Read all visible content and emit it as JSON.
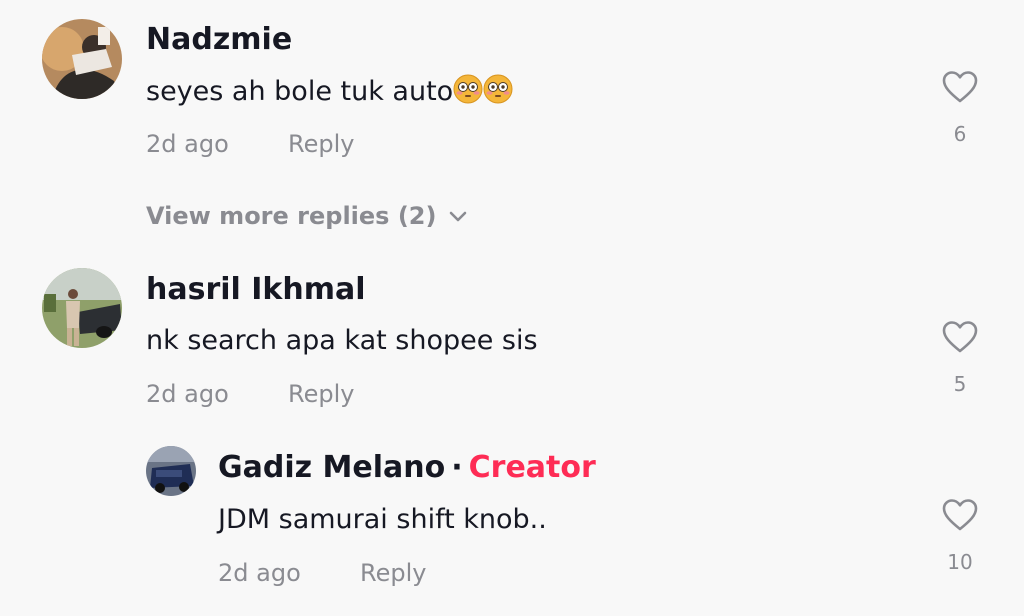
{
  "comments": [
    {
      "username": "Nadzmie",
      "text": "seyes ah bole tuk auto",
      "emoji": [
        "flushed-face",
        "flushed-face"
      ],
      "time": "2d ago",
      "reply_label": "Reply",
      "likes": "6",
      "view_more": "View more replies (2)"
    },
    {
      "username": "hasril Ikhmal",
      "text": "nk search apa kat shopee sis",
      "time": "2d ago",
      "reply_label": "Reply",
      "likes": "5"
    }
  ],
  "reply": {
    "username": "Gadiz Melano",
    "separator": "·",
    "badge": "Creator",
    "text": "JDM samurai shift knob..",
    "time": "2d ago",
    "reply_label": "Reply",
    "likes": "10"
  },
  "colors": {
    "background": "#f8f8f8",
    "text": "#161823",
    "secondary": "#8a8b91",
    "creator": "#fe2c55"
  },
  "icons": {
    "like": "heart-outline-icon",
    "expand": "chevron-down-icon",
    "emoji": "flushed-face-emoji"
  }
}
